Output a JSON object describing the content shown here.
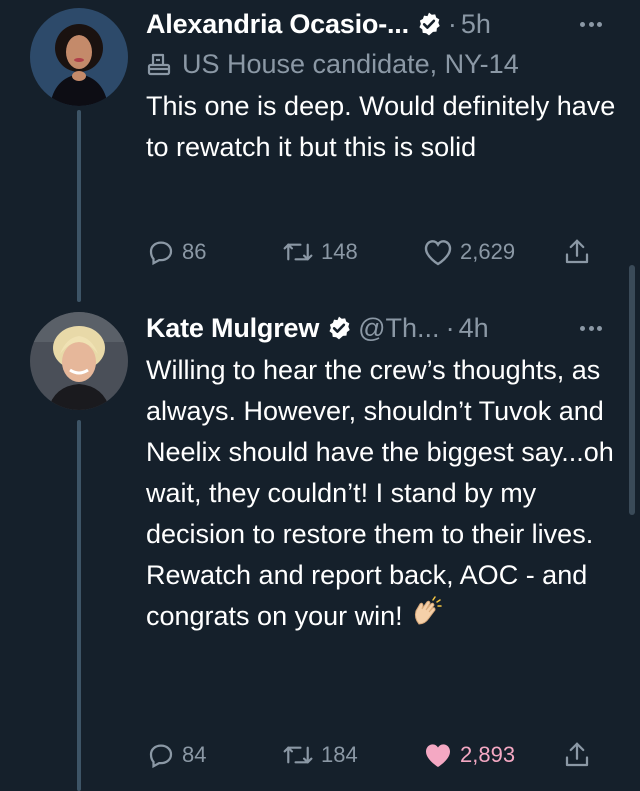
{
  "tweets": [
    {
      "author": "Alexandria Ocasio-...",
      "time_sep": "·",
      "time": "5h",
      "label": "US House candidate, NY-14",
      "text": "This one is deep. Would definitely have to rewatch it but this is solid",
      "replies": "86",
      "retweets": "148",
      "likes": "2,629",
      "liked": false
    },
    {
      "author": "Kate Mulgrew",
      "handle": "@Th...",
      "time_sep": "·",
      "time": "4h",
      "text": "Willing to hear the crew’s thoughts, as always. However, shouldn’t Tuvok and Neelix should have the biggest say...oh wait, they couldn’t! I stand by my decision to restore them to their lives. Rewatch and report back, AOC - and congrats on your win!",
      "replies": "84",
      "retweets": "184",
      "likes": "2,893",
      "liked": true
    }
  ],
  "colors": {
    "background": "#15202b",
    "muted": "#8b98a5",
    "like": "#e0245e",
    "thread_line": "#3d5466"
  },
  "icons": [
    "verified-badge-icon",
    "ballot-box-icon",
    "reply-icon",
    "retweet-icon",
    "heart-icon",
    "share-icon",
    "more-icon",
    "clapping-hands-icon"
  ]
}
